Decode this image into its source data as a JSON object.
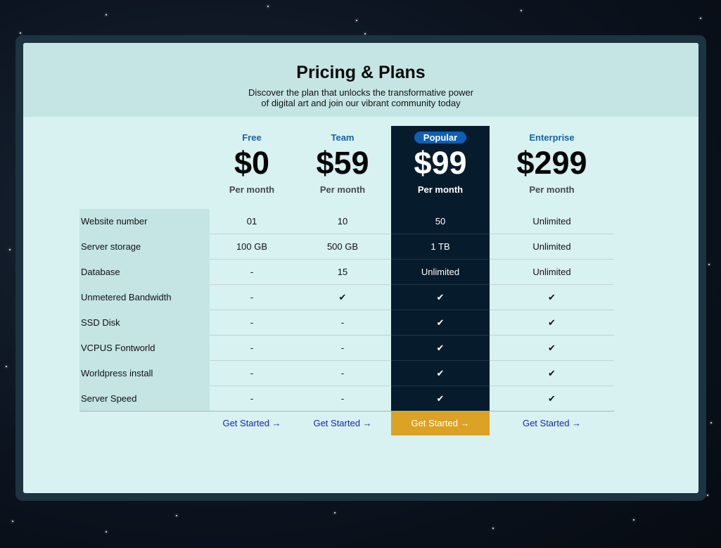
{
  "header": {
    "title": "Pricing & Plans",
    "subtitle_line1": "Discover the plan that unlocks the transformative power",
    "subtitle_line2": "of digital art and join our vibrant community today"
  },
  "plans": [
    {
      "name": "Free",
      "price": "$0",
      "period": "Per month",
      "cta": "Get Started →"
    },
    {
      "name": "Team",
      "price": "$59",
      "period": "Per month",
      "cta": "Get Started →"
    },
    {
      "name": "Popular",
      "price": "$99",
      "period": "Per month",
      "cta": "Get Started →"
    },
    {
      "name": "Enterprise",
      "price": "$299",
      "period": "Per month",
      "cta": "Get Started →"
    }
  ],
  "features": [
    {
      "label": "Website number",
      "values": [
        "01",
        "10",
        "50",
        "Unlimited"
      ]
    },
    {
      "label": "Server storage",
      "values": [
        "100 GB",
        "500 GB",
        "1 TB",
        "Unlimited"
      ]
    },
    {
      "label": "Database",
      "values": [
        "-",
        "15",
        "Unlimited",
        "Unlimited"
      ]
    },
    {
      "label": "Unmetered Bandwidth",
      "values": [
        "-",
        "✔",
        "✔",
        "✔"
      ]
    },
    {
      "label": "SSD Disk",
      "values": [
        "-",
        "-",
        "✔",
        "✔"
      ]
    },
    {
      "label": "VCPUS Fontworld",
      "values": [
        "-",
        "-",
        "✔",
        "✔"
      ]
    },
    {
      "label": "Worldpress install",
      "values": [
        "-",
        "-",
        "✔",
        "✔"
      ]
    },
    {
      "label": "Server Speed",
      "values": [
        "-",
        "-",
        "✔",
        "✔"
      ]
    }
  ],
  "colors": {
    "plan_name": "#1464a8",
    "popular_background": "#061c2c",
    "popular_badge": "#0f5fb4",
    "cta_popular": "#dba224",
    "cta_link": "#1727b0"
  }
}
